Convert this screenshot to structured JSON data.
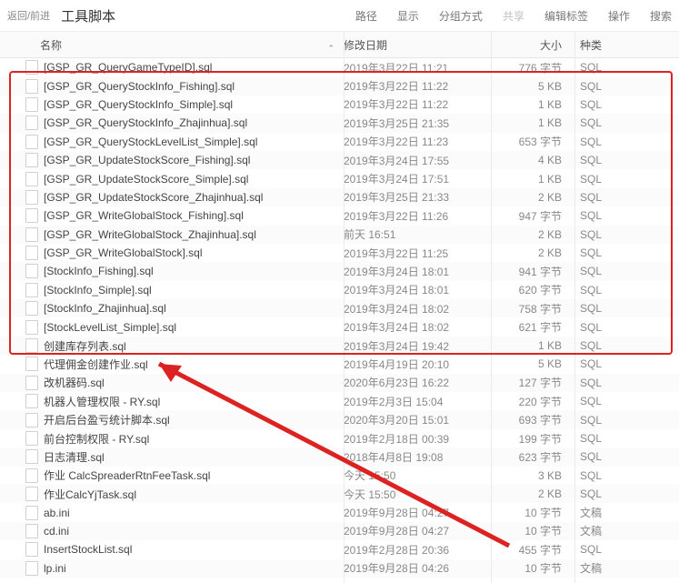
{
  "toolbar": {
    "nav": "返回/前进",
    "title": "工具脚本",
    "menu": {
      "path": "路径",
      "view": "显示",
      "group": "分组方式",
      "share": "共享",
      "tags": "编辑标签",
      "action": "操作",
      "search": "搜索"
    }
  },
  "headers": {
    "name": "名称",
    "date": "修改日期",
    "size": "大小",
    "kind": "种类",
    "sort": "⌃"
  },
  "rows": [
    {
      "name": "[GSP_GR_QueryGameTypeID].sql",
      "date": "2019年3月22日 11:21",
      "size": "776 字节",
      "kind": "SQL",
      "hl": true
    },
    {
      "name": "[GSP_GR_QueryStockInfo_Fishing].sql",
      "date": "2019年3月22日 11:22",
      "size": "5 KB",
      "kind": "SQL",
      "hl": true
    },
    {
      "name": "[GSP_GR_QueryStockInfo_Simple].sql",
      "date": "2019年3月22日 11:22",
      "size": "1 KB",
      "kind": "SQL",
      "hl": true
    },
    {
      "name": "[GSP_GR_QueryStockInfo_Zhajinhua].sql",
      "date": "2019年3月25日 21:35",
      "size": "1 KB",
      "kind": "SQL",
      "hl": true
    },
    {
      "name": "[GSP_GR_QueryStockLevelList_Simple].sql",
      "date": "2019年3月22日 11:23",
      "size": "653 字节",
      "kind": "SQL",
      "hl": true
    },
    {
      "name": "[GSP_GR_UpdateStockScore_Fishing].sql",
      "date": "2019年3月24日 17:55",
      "size": "4 KB",
      "kind": "SQL",
      "hl": true
    },
    {
      "name": "[GSP_GR_UpdateStockScore_Simple].sql",
      "date": "2019年3月24日 17:51",
      "size": "1 KB",
      "kind": "SQL",
      "hl": true
    },
    {
      "name": "[GSP_GR_UpdateStockScore_Zhajinhua].sql",
      "date": "2019年3月25日 21:33",
      "size": "2 KB",
      "kind": "SQL",
      "hl": true
    },
    {
      "name": "[GSP_GR_WriteGlobalStock_Fishing].sql",
      "date": "2019年3月22日 11:26",
      "size": "947 字节",
      "kind": "SQL",
      "hl": true
    },
    {
      "name": "[GSP_GR_WriteGlobalStock_Zhajinhua].sql",
      "date": "前天 16:51",
      "size": "2 KB",
      "kind": "SQL",
      "hl": true
    },
    {
      "name": "[GSP_GR_WriteGlobalStock].sql",
      "date": "2019年3月22日 11:25",
      "size": "2 KB",
      "kind": "SQL",
      "hl": true
    },
    {
      "name": "[StockInfo_Fishing].sql",
      "date": "2019年3月24日 18:01",
      "size": "941 字节",
      "kind": "SQL",
      "hl": true
    },
    {
      "name": "[StockInfo_Simple].sql",
      "date": "2019年3月24日 18:01",
      "size": "620 字节",
      "kind": "SQL",
      "hl": true
    },
    {
      "name": "[StockInfo_Zhajinhua].sql",
      "date": "2019年3月24日 18:02",
      "size": "758 字节",
      "kind": "SQL",
      "hl": true
    },
    {
      "name": "[StockLevelList_Simple].sql",
      "date": "2019年3月24日 18:02",
      "size": "621 字节",
      "kind": "SQL",
      "hl": true
    },
    {
      "name": "创建库存列表.sql",
      "date": "2019年3月24日 19:42",
      "size": "1 KB",
      "kind": "SQL"
    },
    {
      "name": "代理佣金创建作业.sql",
      "date": "2019年4月19日 20:10",
      "size": "5 KB",
      "kind": "SQL"
    },
    {
      "name": "改机器码.sql",
      "date": "2020年6月23日 16:22",
      "size": "127 字节",
      "kind": "SQL"
    },
    {
      "name": "机器人管理权限 - RY.sql",
      "date": "2019年2月3日 15:04",
      "size": "220 字节",
      "kind": "SQL"
    },
    {
      "name": "开启后台盈亏统计脚本.sql",
      "date": "2020年3月20日 15:01",
      "size": "693 字节",
      "kind": "SQL"
    },
    {
      "name": "前台控制权限 - RY.sql",
      "date": "2019年2月18日 00:39",
      "size": "199 字节",
      "kind": "SQL"
    },
    {
      "name": "日志清理.sql",
      "date": "2018年4月8日 19:08",
      "size": "623 字节",
      "kind": "SQL"
    },
    {
      "name": "作业 CalcSpreaderRtnFeeTask.sql",
      "date": "今天 15:50",
      "size": "3 KB",
      "kind": "SQL"
    },
    {
      "name": "作业CalcYjTask.sql",
      "date": "今天 15:50",
      "size": "2 KB",
      "kind": "SQL"
    },
    {
      "name": "ab.ini",
      "date": "2019年9月28日 04:27",
      "size": "10 字节",
      "kind": "文稿"
    },
    {
      "name": "cd.ini",
      "date": "2019年9月28日 04:27",
      "size": "10 字节",
      "kind": "文稿"
    },
    {
      "name": "InsertStockList.sql",
      "date": "2019年2月28日 20:36",
      "size": "455 字节",
      "kind": "SQL"
    },
    {
      "name": "lp.ini",
      "date": "2019年9月28日 04:26",
      "size": "10 字节",
      "kind": "文稿"
    }
  ]
}
